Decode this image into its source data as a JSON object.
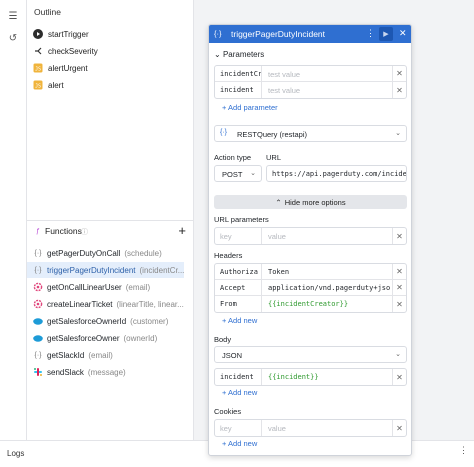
{
  "outline": {
    "title": "Outline",
    "items": [
      {
        "label": "startTrigger",
        "icon": "play-circle-icon"
      },
      {
        "label": "checkSeverity",
        "icon": "branch-icon"
      },
      {
        "label": "alertUrgent",
        "icon": "script-icon"
      },
      {
        "label": "alert",
        "icon": "script-icon"
      }
    ]
  },
  "functions": {
    "title": "Functions",
    "items": [
      {
        "name": "getPagerDutyOnCall",
        "args": "(schedule)",
        "icon": "braces-icon"
      },
      {
        "name": "triggerPagerDutyIncident",
        "args": "(incidentCr...",
        "icon": "braces-icon",
        "selected": true
      },
      {
        "name": "getOnCallLinearUser",
        "args": "(email)",
        "icon": "gear-icon"
      },
      {
        "name": "createLinearTicket",
        "args": "(linearTitle, linear...",
        "icon": "gear-icon"
      },
      {
        "name": "getSalesforceOwnerId",
        "args": "(customer)",
        "icon": "salesforce-icon"
      },
      {
        "name": "getSalesforceOwner",
        "args": "(ownerId)",
        "icon": "salesforce-icon"
      },
      {
        "name": "getSlackId",
        "args": "(email)",
        "icon": "braces-icon"
      },
      {
        "name": "sendSlack",
        "args": "(message)",
        "icon": "slack-icon"
      }
    ]
  },
  "bottom": {
    "logs": "Logs"
  },
  "panel": {
    "title": "triggerPagerDutyIncident",
    "parameters_label": "Parameters",
    "parameters": [
      {
        "key": "incidentCr",
        "value_placeholder": "test value"
      },
      {
        "key": "incident",
        "value_placeholder": "test value"
      }
    ],
    "add_parameter": "+ Add parameter",
    "resource": "RESTQuery (restapi)",
    "action_type_label": "Action type",
    "action_type": "POST",
    "url_label": "URL",
    "url": "https://api.pagerduty.com/incidents",
    "hide_options": "Hide more options",
    "url_params_label": "URL parameters",
    "url_params_key_ph": "key",
    "url_params_value_ph": "value",
    "headers_label": "Headers",
    "headers": [
      {
        "key": "Authoriza",
        "value": "Token"
      },
      {
        "key": "Accept",
        "value": "application/vnd.pagerduty+jso"
      },
      {
        "key": "From",
        "value": "{{incidentCreator}}"
      }
    ],
    "add_new": "+ Add new",
    "body_label": "Body",
    "body_type": "JSON",
    "body_rows": [
      {
        "key": "incident",
        "value": "{{incident}}"
      }
    ],
    "cookies_label": "Cookies",
    "cookies_key_ph": "key",
    "cookies_value_ph": "value"
  },
  "colors": {
    "accent": "#2f6fd1",
    "template_green": "#2f9a2f",
    "selected_bg": "#e4eefb"
  }
}
